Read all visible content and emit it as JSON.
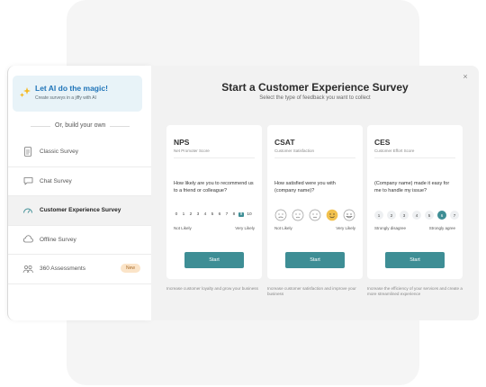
{
  "ai": {
    "title": "Let AI do the magic!",
    "subtitle": "Create surveys in a jiffy with AI"
  },
  "divider": {
    "label": "Or, build your own"
  },
  "menu": [
    {
      "label": "Classic Survey",
      "icon": "document-icon",
      "active": false
    },
    {
      "label": "Chat Survey",
      "icon": "chat-icon",
      "active": false
    },
    {
      "label": "Customer Experience Survey",
      "icon": "gauge-icon",
      "active": true
    },
    {
      "label": "Offline Survey",
      "icon": "cloud-icon",
      "active": false
    },
    {
      "label": "360 Assessments",
      "icon": "people-icon",
      "active": false,
      "badge": "New"
    }
  ],
  "modal": {
    "title": "Start a Customer Experience Survey",
    "subtitle": "Select the type of feedback you want to collect",
    "close": "×"
  },
  "cards": {
    "nps": {
      "title": "NPS",
      "subtitle": "Net Promoter Score",
      "question": "How likely are you to recommend us to a friend or colleague?",
      "scale": [
        "0",
        "1",
        "2",
        "3",
        "4",
        "5",
        "6",
        "7",
        "8",
        "9",
        "10"
      ],
      "selected": "9",
      "low": "Not Likely",
      "high": "Very Likely",
      "start": "Start",
      "footer": "Increase customer loyalty and grow your business"
    },
    "csat": {
      "title": "CSAT",
      "subtitle": "Customer Satisfaction",
      "question": "How satisfied were you with (company name)?",
      "selected_face": 4,
      "low": "Not Likely",
      "high": "Very Likely",
      "start": "Start",
      "footer": "Increase customer satisfaction and improve your business"
    },
    "ces": {
      "title": "CES",
      "subtitle": "Customer Effort Score",
      "question": "(Company name) made it easy for me to handle my issue?",
      "scale": [
        "1",
        "2",
        "3",
        "4",
        "5",
        "6",
        "7"
      ],
      "selected": "6",
      "low": "Strongly disagree",
      "high": "Strongly agree",
      "start": "Start",
      "footer": "Increase the efficiency of your services and create a more streamlined experience"
    }
  },
  "colors": {
    "accent": "#3e8e95",
    "ai_title": "#1f74b8",
    "badge_bg": "#fbe4c8",
    "selected_face": "#f2c14e"
  }
}
